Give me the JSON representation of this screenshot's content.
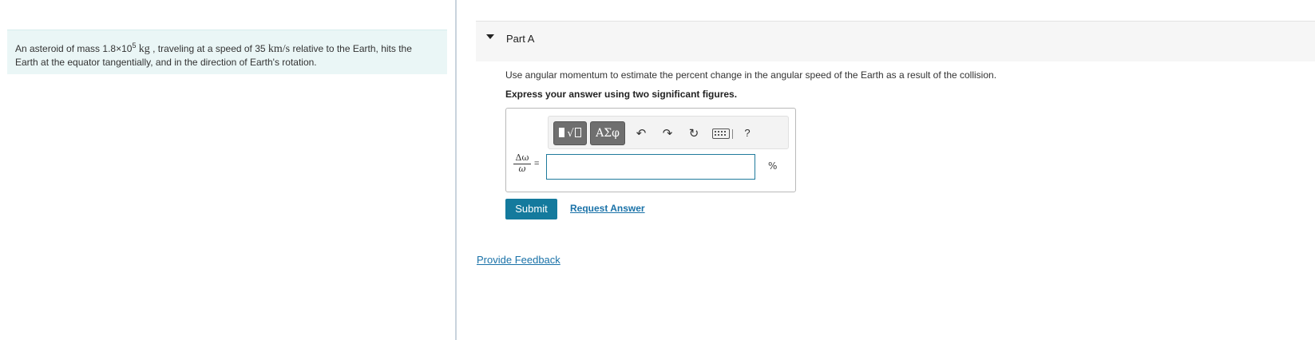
{
  "problem": {
    "text_before_mass": "An asteroid of mass ",
    "mass_mantissa": "1.8×10",
    "mass_exponent": "5",
    "mass_unit": "kg",
    "text_after_mass": " , traveling at a speed of 35 ",
    "speed_unit": "km/s",
    "text_end_line1": " relative to the Earth, hits the",
    "text_line2": "Earth at the equator tangentially, and in the direction of Earth's rotation."
  },
  "part": {
    "title": "Part A",
    "question": "Use angular momentum to estimate the percent change in the angular speed of the Earth as a result of the collision.",
    "instruction": "Express your answer using two significant figures."
  },
  "toolbar": {
    "greek_label": "ΑΣφ",
    "undo_icon": "undo-icon",
    "redo_icon": "redo-icon",
    "reset_icon": "reset-icon",
    "keyboard_icon": "keyboard-icon",
    "help_label": "?"
  },
  "answer": {
    "fraction_numerator": "Δω",
    "fraction_denominator": "ω",
    "equals": "=",
    "value": "",
    "unit": "%"
  },
  "actions": {
    "submit_label": "Submit",
    "request_answer_label": "Request Answer",
    "feedback_label": "Provide Feedback"
  },
  "colors": {
    "problem_bg": "#eaf6f6",
    "accent": "#147a9d",
    "link": "#1a72a8"
  }
}
